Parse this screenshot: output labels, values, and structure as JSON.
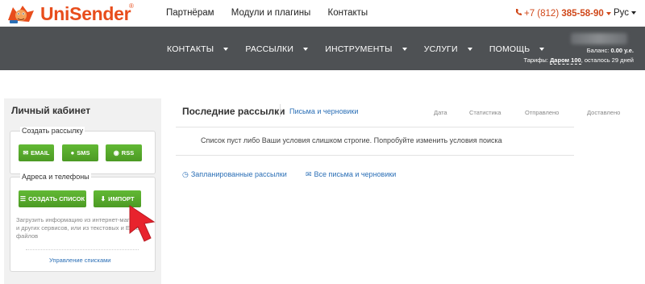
{
  "brand": {
    "name": "UniSender",
    "reg": "®",
    "primary_color": "#e84d1c",
    "mascot_icon": "fox-mascot-icon"
  },
  "topnav": [
    "Партнёрам",
    "Модули и плагины",
    "Контакты"
  ],
  "phone": {
    "prefix": "+7 (812) ",
    "number": "385-58-90",
    "icon": "phone-icon"
  },
  "lang": "Рус",
  "mainnav": [
    "КОНТАКТЫ",
    "РАССЫЛКИ",
    "ИНСТРУМЕНТЫ",
    "УСЛУГИ",
    "ПОМОЩЬ"
  ],
  "account": {
    "balance_label": "Баланс: ",
    "balance_value": "0.00 у.е.",
    "tariff_label": "Тарифы: ",
    "tariff_value": "Даром 100",
    "tariff_suffix": ", осталось 29 дней"
  },
  "left": {
    "title": "Личный кабинет",
    "create": {
      "label": "Создать рассылку",
      "buttons": [
        {
          "label": "EMAIL",
          "icon": "envelope-icon"
        },
        {
          "label": "SMS",
          "icon": "chat-bubble-icon"
        },
        {
          "label": "RSS",
          "icon": "rss-icon"
        }
      ]
    },
    "contacts": {
      "label": "Адреса и телефоны",
      "create_list": "СОЗДАТЬ СПИСОК",
      "import": "ИМПОРТ",
      "hint": "Загрузить информацию из интернет-магазинов и других сервисов, или из текстовых и Excel файлов",
      "manage_link": "Управление списками"
    }
  },
  "main": {
    "title": "Последние рассылки",
    "tab": "Письма и черновики",
    "columns": [
      "Дата",
      "Статистика",
      "Отправлено",
      "Доставлено"
    ],
    "empty_message": "Список пуст либо Ваши условия слишком строгие. Попробуйте изменить условия поиска",
    "links": [
      {
        "label": "Запланированные рассылки",
        "icon": "clock-icon"
      },
      {
        "label": "Все письма и черновики",
        "icon": "envelope-icon"
      }
    ]
  },
  "colors": {
    "nav_band": "#4e5154",
    "button_green": "#56a92b",
    "link_blue": "#2b6fb6",
    "arrow_red": "#e8232d"
  }
}
